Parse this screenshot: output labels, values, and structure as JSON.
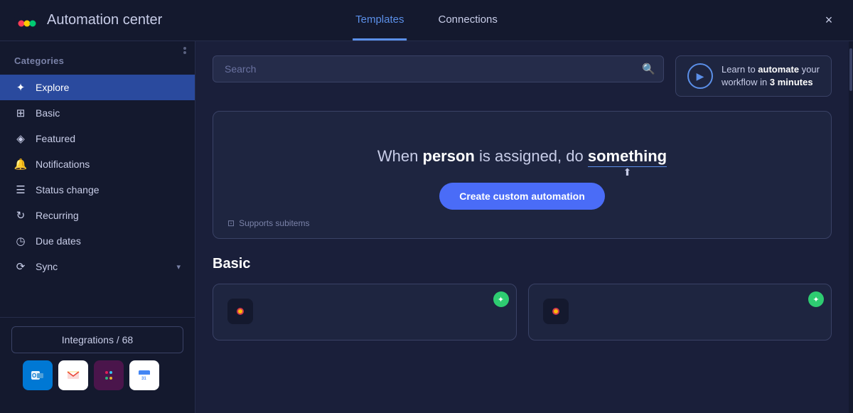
{
  "header": {
    "title": "Automation",
    "title_suffix": " center",
    "tabs": [
      {
        "id": "templates",
        "label": "Templates",
        "active": true
      },
      {
        "id": "connections",
        "label": "Connections",
        "active": false
      }
    ],
    "close_label": "×"
  },
  "sidebar": {
    "categories_label": "Categories",
    "items": [
      {
        "id": "explore",
        "label": "Explore",
        "icon": "✦",
        "active": true
      },
      {
        "id": "basic",
        "label": "Basic",
        "icon": "⊞",
        "active": false
      },
      {
        "id": "featured",
        "label": "Featured",
        "icon": "◈",
        "active": false
      },
      {
        "id": "notifications",
        "label": "Notifications",
        "icon": "🔔",
        "active": false
      },
      {
        "id": "status-change",
        "label": "Status change",
        "icon": "☰",
        "active": false
      },
      {
        "id": "recurring",
        "label": "Recurring",
        "icon": "↻",
        "active": false
      },
      {
        "id": "due-dates",
        "label": "Due dates",
        "icon": "◷",
        "active": false
      },
      {
        "id": "sync",
        "label": "Sync",
        "icon": "⟳",
        "active": false,
        "has_arrow": true
      }
    ],
    "integrations_btn": "Integrations / 68"
  },
  "search": {
    "placeholder": "Search"
  },
  "learn_widget": {
    "text_before": "Learn to ",
    "text_bold1": "automate",
    "text_after": " your workflow in ",
    "text_bold2": "3 minutes"
  },
  "custom_automation": {
    "phrase_before": "When ",
    "phrase_bold1": "person",
    "phrase_middle": " is assigned, do ",
    "phrase_bold2": "something",
    "create_btn": "Create custom automation",
    "supports_subitems": "Supports subitems"
  },
  "basic_section": {
    "title": "Basic"
  }
}
